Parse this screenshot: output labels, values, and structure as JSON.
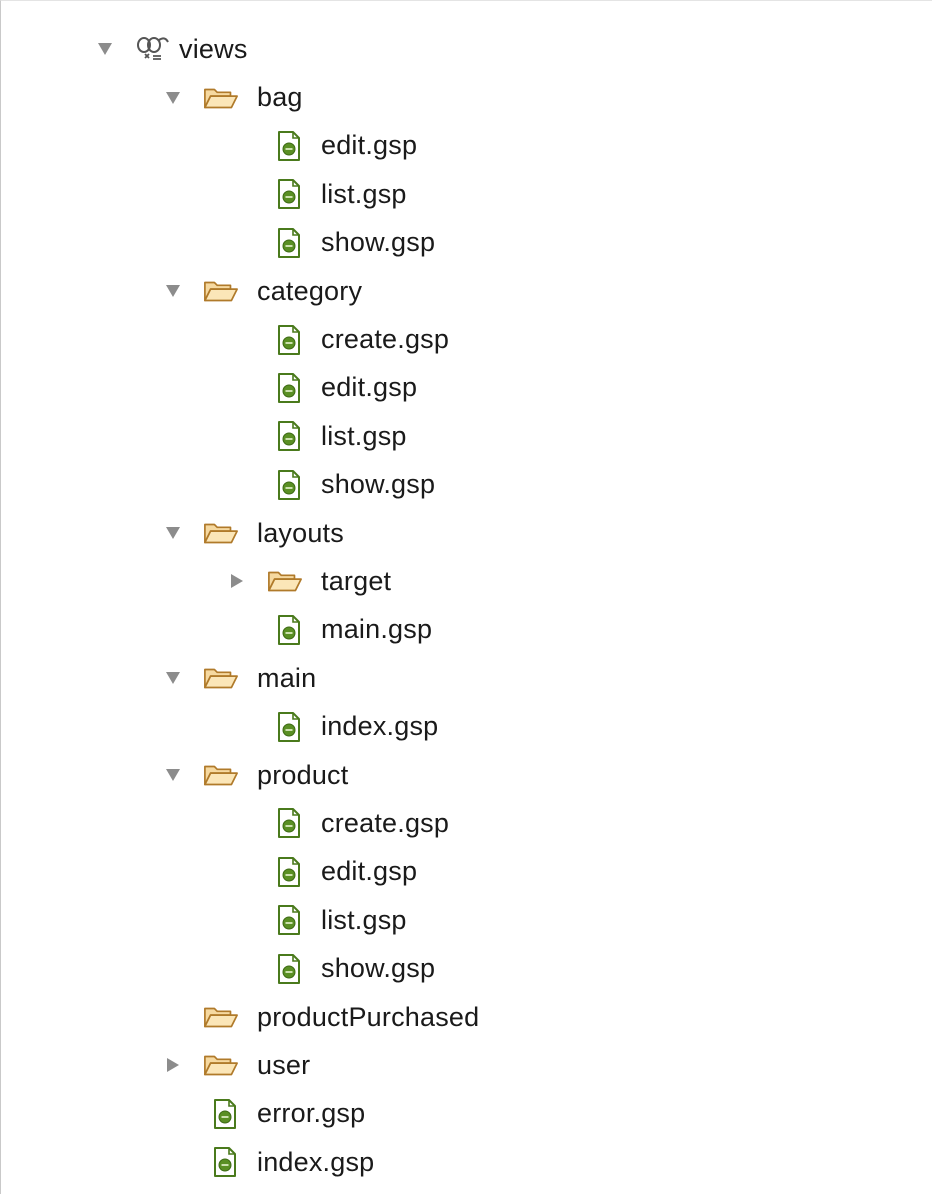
{
  "tree": {
    "root": {
      "label": "views",
      "icon": "views-package-icon",
      "expanded": true
    },
    "items": [
      {
        "label": "bag",
        "type": "folder",
        "depth": 1,
        "expanded": true
      },
      {
        "label": "edit.gsp",
        "type": "file",
        "depth": 2
      },
      {
        "label": "list.gsp",
        "type": "file",
        "depth": 2
      },
      {
        "label": "show.gsp",
        "type": "file",
        "depth": 2
      },
      {
        "label": "category",
        "type": "folder",
        "depth": 1,
        "expanded": true
      },
      {
        "label": "create.gsp",
        "type": "file",
        "depth": 2
      },
      {
        "label": "edit.gsp",
        "type": "file",
        "depth": 2
      },
      {
        "label": "list.gsp",
        "type": "file",
        "depth": 2
      },
      {
        "label": "show.gsp",
        "type": "file",
        "depth": 2
      },
      {
        "label": "layouts",
        "type": "folder",
        "depth": 1,
        "expanded": true
      },
      {
        "label": "target",
        "type": "folder",
        "depth": 2,
        "expanded": false
      },
      {
        "label": "main.gsp",
        "type": "file",
        "depth": 2
      },
      {
        "label": "main",
        "type": "folder",
        "depth": 1,
        "expanded": true
      },
      {
        "label": "index.gsp",
        "type": "file",
        "depth": 2
      },
      {
        "label": "product",
        "type": "folder",
        "depth": 1,
        "expanded": true
      },
      {
        "label": "create.gsp",
        "type": "file",
        "depth": 2
      },
      {
        "label": "edit.gsp",
        "type": "file",
        "depth": 2
      },
      {
        "label": "list.gsp",
        "type": "file",
        "depth": 2
      },
      {
        "label": "show.gsp",
        "type": "file",
        "depth": 2
      },
      {
        "label": "productPurchased",
        "type": "folder",
        "depth": 1,
        "expanded": null
      },
      {
        "label": "user",
        "type": "folder",
        "depth": 1,
        "expanded": false
      },
      {
        "label": "error.gsp",
        "type": "file",
        "depth": 1
      },
      {
        "label": "index.gsp",
        "type": "file",
        "depth": 1
      }
    ]
  },
  "colors": {
    "folder_fill": "#f6d9a0",
    "folder_stroke": "#b07a2a",
    "file_stroke": "#4a7a1c",
    "file_fill": "#eef6e0",
    "twisty": "#8c8c8c",
    "text": "#1a1a1a"
  }
}
